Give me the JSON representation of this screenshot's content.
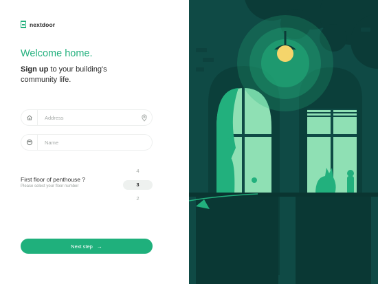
{
  "brand": {
    "name": "nextdoor",
    "accent": "#22b07d"
  },
  "heading": {
    "welcome": "Welcome home.",
    "signup_bold": "Sign up",
    "signup_rest": " to your building's community life."
  },
  "form": {
    "address": {
      "placeholder": "Address",
      "lead_icon": "home-icon",
      "trail_icon": "location-pin-icon"
    },
    "name": {
      "placeholder": "Name",
      "lead_icon": "face-icon"
    }
  },
  "floor": {
    "question": "First floor of penthouse ?",
    "hint": "Please select your floor number",
    "options": {
      "above": "4",
      "selected": "3",
      "below": "2"
    }
  },
  "actions": {
    "next_label": "Next step",
    "next_icon": "arrow-right-icon"
  },
  "illustration": {
    "colors": {
      "wall": "#0f4a45",
      "window": "#8fe0b4",
      "lamp": "#f5d56b",
      "glow": "#23b07c"
    }
  }
}
